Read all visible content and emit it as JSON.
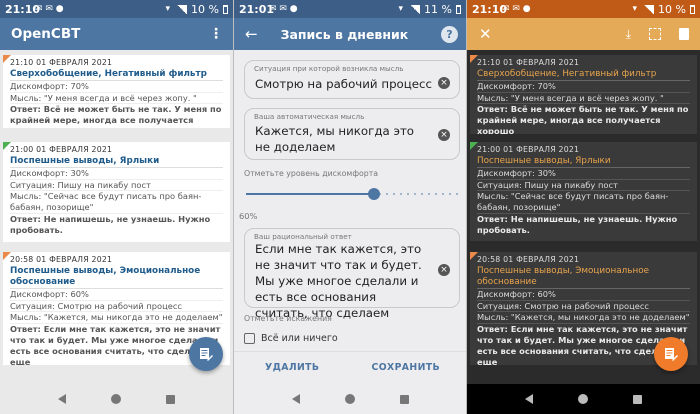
{
  "colors": {
    "app_bar": "#4e76a3",
    "accent_orange": "#f07c2b",
    "dark_bar": "#e4aa57",
    "title_blue": "#1f5b8b",
    "title_orange": "#e8a44d"
  },
  "screen1": {
    "status": {
      "time": "21:10",
      "battery": "10 %"
    },
    "app_title": "OpenCBT",
    "menu_icon": "overflow-menu-icon",
    "fab_icon": "edit-note-icon",
    "entries": [
      {
        "time": "21:10 01 ФЕВРАЛЯ 2021",
        "title": "Сверхобобщение, Негативный фильтр",
        "discomfort": "Дискомфорт: 70%",
        "thought": "Мысль: \"У меня всегда и всё через жопу. \"",
        "answer": "Ответ: Всё не может быть не так. У меня по крайней мере, иногда все получается хорошо"
      },
      {
        "time": "21:00 01 ФЕВРАЛЯ 2021",
        "title": "Поспешные выводы, Ярлыки",
        "discomfort": "Дискомфорт: 30%",
        "situation": "Ситуация: Пишу на пикабу пост",
        "thought": "Мысль: \"Сейчас все будут писать про баян-бабаян, позорище\"",
        "answer": "Ответ: Не напишешь, не узнаешь. Нужно пробовать."
      },
      {
        "time": "20:58 01 ФЕВРАЛЯ 2021",
        "title": "Поспешные выводы, Эмоциональное обоснование",
        "discomfort": "Дискомфорт: 60%",
        "situation": "Ситуация: Смотрю на рабочий процесс",
        "thought": "Мысль: \"Кажется, мы никогда это не доделаем\"",
        "answer": "Ответ: Если мне так кажется, это не значит что так и будет. Мы уже многое сделали и есть все основания считать, что сделаем еще"
      }
    ]
  },
  "screen2": {
    "status": {
      "time": "21:01",
      "battery": "11 %"
    },
    "title": "Запись в дневник",
    "back_icon": "arrow-back-icon",
    "help_icon": "help-icon",
    "situation_label": "Ситуация при которой возникла мысль",
    "situation_value": "Смотрю на рабочий процесс",
    "thought_label": "Ваша автоматическая мысль",
    "thought_value": "Кажется, мы никогда это не доделаем",
    "discomfort_label": "Отметьте уровень дискомфорта",
    "discomfort_level": 0.6,
    "discomfort_value": "60%",
    "rational_label": "Ваш рациональный ответ",
    "rational_value": "Если мне так кажется, это не значит что так и будет. Мы уже многое сделали и есть все основания считать, что сделаем",
    "distortions_label": "Отметьте искажения",
    "checkbox_label": "Всё или ничего",
    "delete_button": "УДАЛИТЬ",
    "save_button": "СОХРАНИТЬ"
  },
  "screen3": {
    "status": {
      "time": "21:10",
      "battery": "10 %"
    },
    "close_icon": "close-icon",
    "download_icon": "download-icon",
    "select_icon": "select-all-icon",
    "delete_icon": "trash-icon",
    "fab_icon": "edit-note-icon",
    "entries": [
      {
        "time": "21:10 01 ФЕВРАЛЯ 2021",
        "title": "Сверхобобщение, Негативный фильтр",
        "discomfort": "Дискомфорт: 70%",
        "thought": "Мысль: \"У меня всегда и всё через жопу. \"",
        "answer": "Ответ: Всё не может быть не так. У меня по крайней мере, иногда все получается хорошо"
      },
      {
        "time": "21:00 01 ФЕВРАЛЯ 2021",
        "title": "Поспешные выводы, Ярлыки",
        "discomfort": "Дискомфорт: 30%",
        "situation": "Ситуация: Пишу на пикабу пост",
        "thought": "Мысль: \"Сейчас все будут писать про баян-бабаян, позорище\"",
        "answer": "Ответ: Не напишешь, не узнаешь. Нужно пробовать."
      },
      {
        "time": "20:58 01 ФЕВРАЛЯ 2021",
        "title": "Поспешные выводы, Эмоциональное обоснование",
        "discomfort": "Дискомфорт: 60%",
        "situation": "Ситуация: Смотрю на рабочий процесс",
        "thought": "Мысль: \"Кажется, мы никогда это не доделаем\"",
        "answer": "Ответ: Если мне так кажется, это не значит что так и будет. Мы уже многое сделали и есть все основания считать, что сделаем еще"
      }
    ]
  }
}
